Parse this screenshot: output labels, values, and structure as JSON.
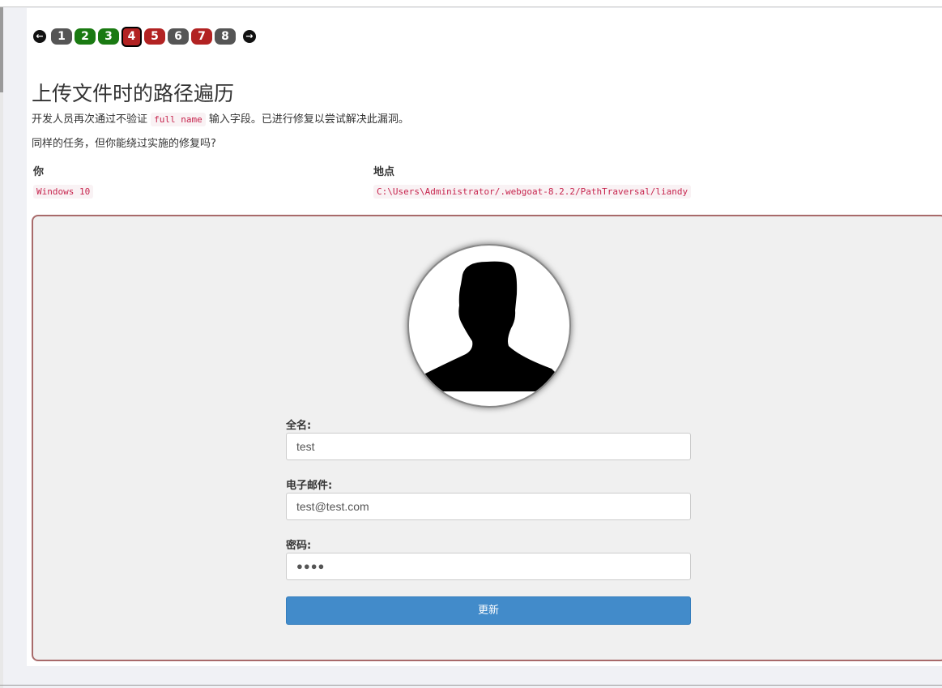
{
  "pager": {
    "prev_icon": "arrow-left-icon",
    "next_icon": "arrow-right-icon",
    "pages": [
      {
        "label": "1",
        "color": "#555555",
        "status": "gray"
      },
      {
        "label": "2",
        "color": "#1a7a12",
        "status": "green"
      },
      {
        "label": "3",
        "color": "#1a7a12",
        "status": "green"
      },
      {
        "label": "4",
        "color": "#b22222",
        "status": "current"
      },
      {
        "label": "5",
        "color": "#b22222",
        "status": "red"
      },
      {
        "label": "6",
        "color": "#555555",
        "status": "gray"
      },
      {
        "label": "7",
        "color": "#b22222",
        "status": "red"
      },
      {
        "label": "8",
        "color": "#555555",
        "status": "gray"
      }
    ]
  },
  "lesson": {
    "title": "上传文件时的路径遍历",
    "para1_before": "开发人员再次通过不验证",
    "para1_code": "full name",
    "para1_after": "输入字段。已进行修复以尝试解决此漏洞。",
    "para2": "同样的任务，但你能绕过实施的修复吗?"
  },
  "table": {
    "col1_header": "你",
    "col2_header": "地点",
    "col1_value": "Windows 10",
    "col2_value": "C:\\Users\\Administrator/.webgoat-8.2.2/PathTraversal/liandy"
  },
  "form": {
    "avatar_icon": "user-silhouette-icon",
    "fullname_label": "全名:",
    "fullname_value": "test",
    "email_label": "电子邮件:",
    "email_value": "test@test.com",
    "password_label": "密码:",
    "password_value": "●●●●",
    "submit_label": "更新"
  },
  "colors": {
    "panel_border": "#a86a6a",
    "button": "#428bca",
    "code_text": "#c7254e"
  }
}
